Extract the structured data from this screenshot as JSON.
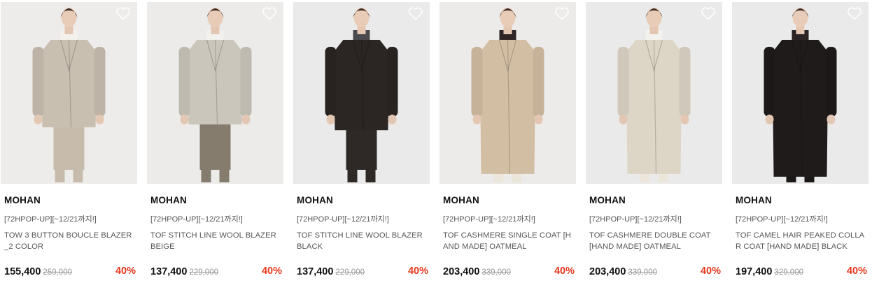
{
  "products": [
    {
      "brand": "MOHAN",
      "promo": "[72HPOP-UP][~12/21까지!]",
      "name": "TOW 3 BUTTON BOUCLE BLAZER _2 COLOR",
      "price": "155,400",
      "original_price": "259,000",
      "discount": "40%",
      "bg": "#eeeceb",
      "coat": "#c9bfb1",
      "coat_len": 0.6,
      "inner": "#f4f1ec",
      "bottom": "#c7bbac",
      "shoe": "#c7bbac"
    },
    {
      "brand": "MOHAN",
      "promo": "[72HPOP-UP][~12/21까지!]",
      "name": "TOF STITCH LINE WOOL BLAZER BEIGE",
      "price": "137,400",
      "original_price": "229,000",
      "discount": "40%",
      "bg": "#ecebea",
      "coat": "#cbc6bc",
      "coat_len": 0.58,
      "inner": "#f2f1ee",
      "bottom": "#857c6d",
      "shoe": "#857c6d"
    },
    {
      "brand": "MOHAN",
      "promo": "[72HPOP-UP][~12/21까지!]",
      "name": "TOF STITCH LINE WOOL BLAZER BLACK",
      "price": "137,400",
      "original_price": "229,000",
      "discount": "40%",
      "bg": "#ebeaea",
      "coat": "#2b2623",
      "coat_len": 0.62,
      "inner": "#4a4a4e",
      "bottom": "#2e2926",
      "shoe": "#2e2926"
    },
    {
      "brand": "MOHAN",
      "promo": "[72HPOP-UP][~12/21까지!]",
      "name": "TOF CASHMERE SINGLE COAT [HAND MADE] OATMEAL",
      "price": "203,400",
      "original_price": "339,000",
      "discount": "40%",
      "bg": "#ecebea",
      "coat": "#d2bea3",
      "coat_len": 0.93,
      "inner": "#2f2526",
      "bottom": "#3a2a2b",
      "shoe": "#ece6da"
    },
    {
      "brand": "MOHAN",
      "promo": "[72HPOP-UP][~12/21까지!]",
      "name": "TOF CASHMERE DOUBLE COAT [HAND MADE] OATMEAL",
      "price": "203,400",
      "original_price": "339,000",
      "discount": "40%",
      "bg": "#ebeaea",
      "coat": "#ddd5c6",
      "coat_len": 0.93,
      "inner": "#f4f2ee",
      "bottom": "#1f1d1d",
      "shoe": "#ece6da"
    },
    {
      "brand": "MOHAN",
      "promo": "[72HPOP-UP][~12/21까지!]",
      "name": "TOF CAMEL HAIR PEAKED COLLAR COAT [HAND MADE] BLACK",
      "price": "197,400",
      "original_price": "329,000",
      "discount": "40%",
      "bg": "#ebeaea",
      "coat": "#1f1b1a",
      "coat_len": 0.95,
      "inner": "#2a2524",
      "bottom": "#252120",
      "shoe": "#1a1716"
    }
  ]
}
